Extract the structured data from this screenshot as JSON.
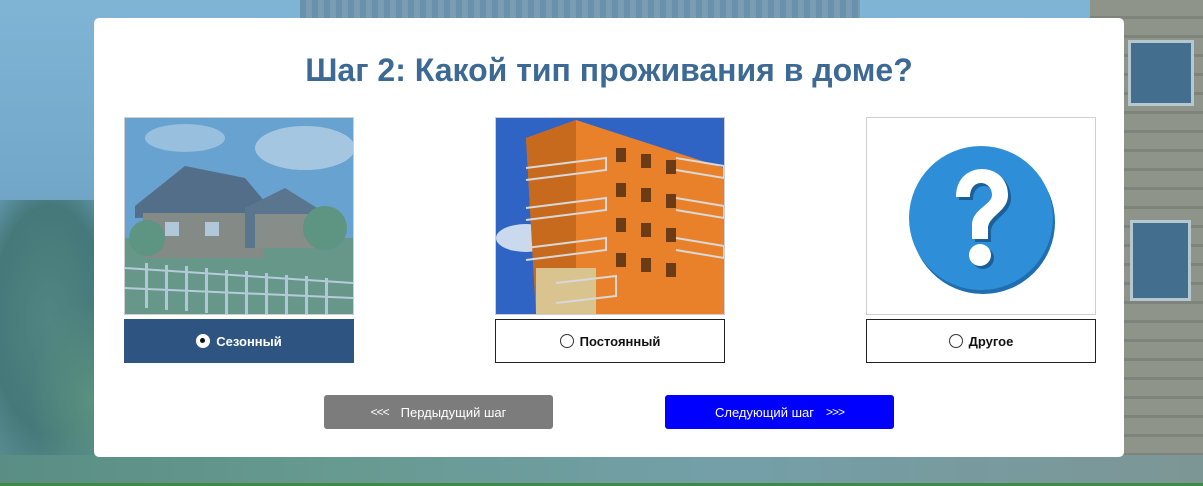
{
  "step_title": "Шаг 2: Какой тип проживания в доме?",
  "options": [
    {
      "label": "Сезонный",
      "selected": true,
      "image": "country-house-photo"
    },
    {
      "label": "Постоянный",
      "selected": false,
      "image": "apartment-building-photo"
    },
    {
      "label": "Другое",
      "selected": false,
      "image": "question-mark-icon"
    }
  ],
  "navigation": {
    "prev_label": "Пердыдущий шаг",
    "prev_arrows": "<<<",
    "next_label": "Следующий шаг",
    "next_arrows": ">>>"
  },
  "colors": {
    "title": "#3d6a94",
    "selected_option": "#2e5582",
    "prev_button": "#7c7c7c",
    "next_button": "#0000ff",
    "question_circle": "#2e8fd8"
  }
}
